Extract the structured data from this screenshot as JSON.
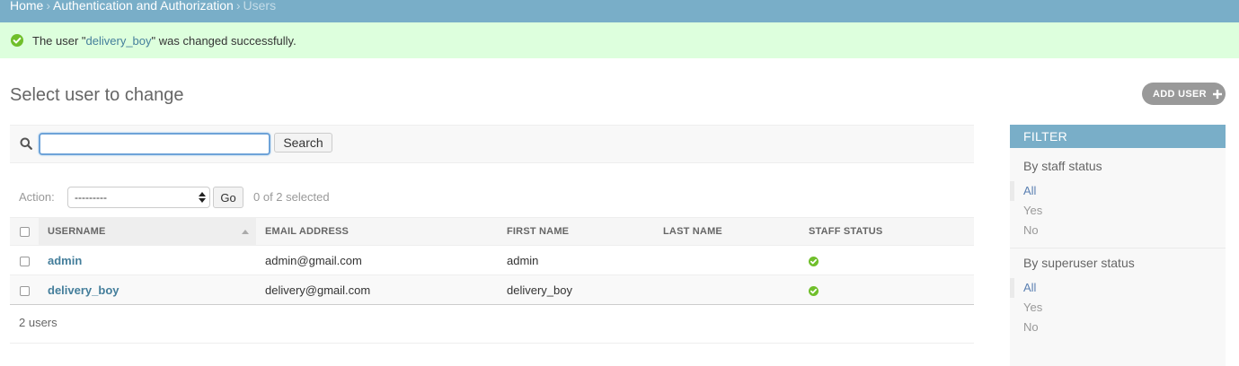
{
  "breadcrumb": {
    "home": "Home",
    "app": "Authentication and Authorization",
    "current": "Users",
    "separator": "›"
  },
  "message": {
    "prefix": "The user \"",
    "link": "delivery_boy",
    "suffix": "\" was changed successfully."
  },
  "page": {
    "title": "Select user to change",
    "add_button": "ADD USER"
  },
  "search": {
    "value": "",
    "button": "Search"
  },
  "actions": {
    "label": "Action:",
    "selected": "---------",
    "go": "Go",
    "counter": "0 of 2 selected"
  },
  "table": {
    "headers": [
      "USERNAME",
      "EMAIL ADDRESS",
      "FIRST NAME",
      "LAST NAME",
      "STAFF STATUS"
    ],
    "rows": [
      {
        "username": "admin",
        "email": "admin@gmail.com",
        "first_name": "admin",
        "last_name": "",
        "staff_status": true
      },
      {
        "username": "delivery_boy",
        "email": "delivery@gmail.com",
        "first_name": "delivery_boy",
        "last_name": "",
        "staff_status": true
      }
    ]
  },
  "paginator": "2 users",
  "filter": {
    "title": "FILTER",
    "groups": [
      {
        "title": "By staff status",
        "options": [
          "All",
          "Yes",
          "No"
        ],
        "selected": "All"
      },
      {
        "title": "By superuser status",
        "options": [
          "All",
          "Yes",
          "No"
        ],
        "selected": "All"
      }
    ]
  },
  "colors": {
    "header_blue": "#79aec8",
    "link_blue": "#447e9b",
    "success_bg": "#dddddd",
    "success_green": "#70bf2b",
    "button_grey": "#999999"
  },
  "icons": {
    "message": "check-circle-icon",
    "search": "search-icon",
    "add": "plus-icon",
    "staff_yes": "check-circle-icon",
    "sort": "sort-ascending-icon"
  }
}
